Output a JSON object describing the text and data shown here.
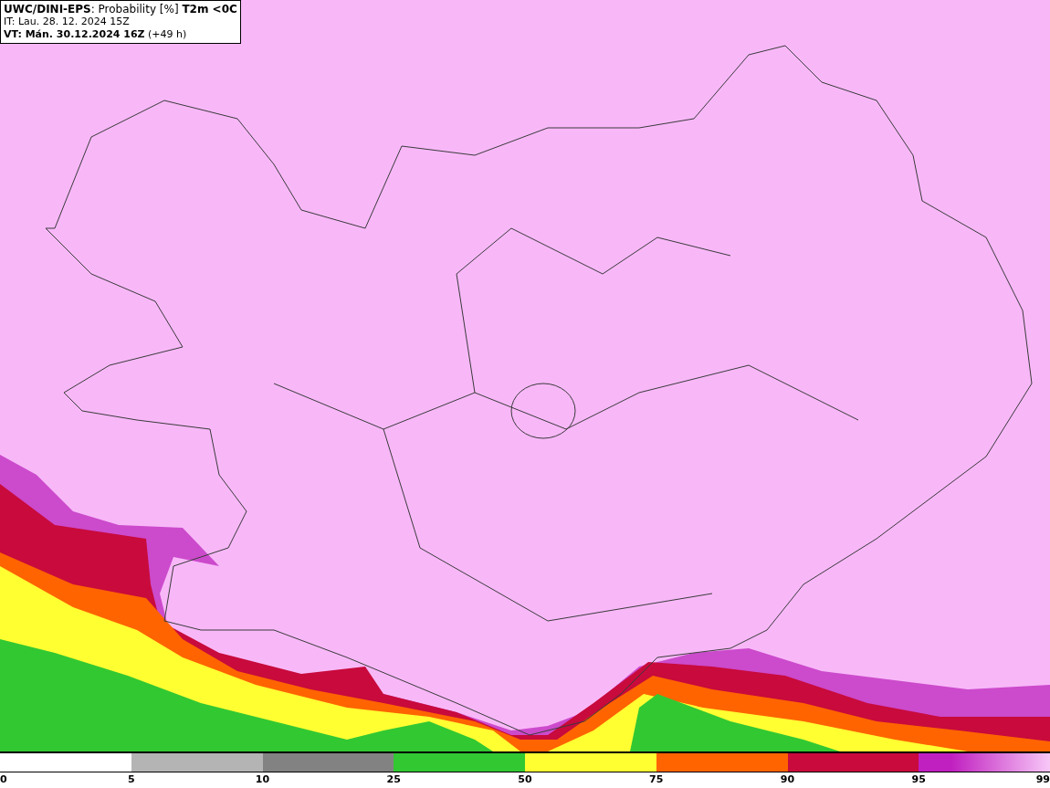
{
  "header": {
    "title": "**UWC/DINI-EPS**: Probability [%] **T2m <0C**",
    "init_time": "IT: Lau. 28. 12. 2024 15Z",
    "valid_time": "**VT: Mán. 30.12.2024 16Z** (+49 h)"
  },
  "legend": {
    "segments": [
      {
        "color": "#ffffff"
      },
      {
        "color": "#b4b4b4"
      },
      {
        "color": "#828282"
      },
      {
        "color": "#32c832"
      },
      {
        "color": "#ffff32"
      },
      {
        "color": "#ff6400"
      },
      {
        "color": "#c80a3c"
      },
      {
        "color": "#c020c0"
      }
    ],
    "ticks": [
      "0",
      "5",
      "10",
      "25",
      "50",
      "75",
      "90",
      "95",
      "99"
    ]
  }
}
